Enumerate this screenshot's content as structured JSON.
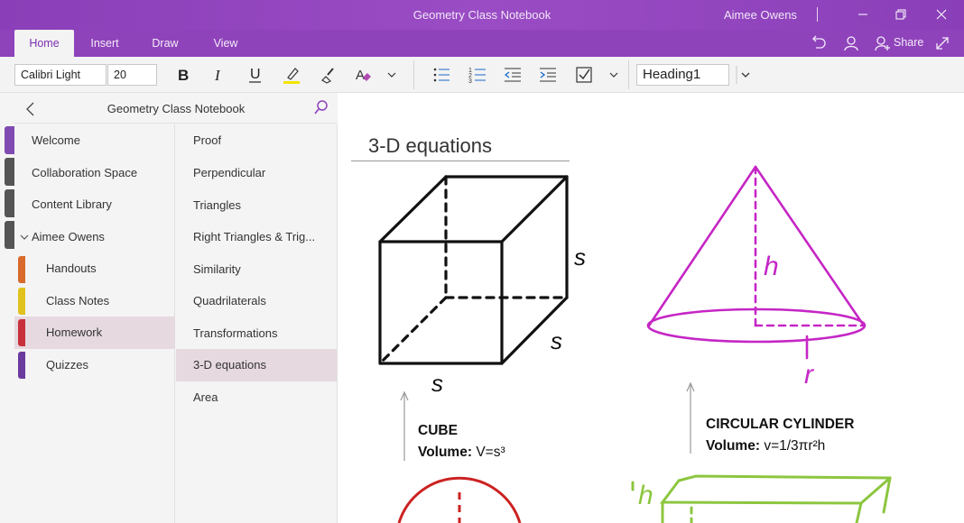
{
  "window": {
    "title": "Geometry Class Notebook",
    "user": "Aimee Owens"
  },
  "ribbon": {
    "tabs": [
      {
        "label": "Home",
        "active": true
      },
      {
        "label": "Insert",
        "active": false
      },
      {
        "label": "Draw",
        "active": false
      },
      {
        "label": "View",
        "active": false
      }
    ],
    "share_label": "Share"
  },
  "toolbar": {
    "font_name": "Calibri Light",
    "font_size": "20",
    "style": "Heading1"
  },
  "nav": {
    "notebook_title": "Geometry Class Notebook",
    "sections": [
      {
        "label": "Welcome",
        "color": "#7f4bb0"
      },
      {
        "label": "Collaboration Space",
        "color": "#555555"
      },
      {
        "label": "Content Library",
        "color": "#555555"
      },
      {
        "label": "Aimee Owens",
        "color": "#555555"
      },
      {
        "label": "Handouts",
        "color": "#d86a2c"
      },
      {
        "label": "Class Notes",
        "color": "#e0c21e"
      },
      {
        "label": "Homework",
        "color": "#c8303c"
      },
      {
        "label": "Quizzes",
        "color": "#6a3a9e"
      }
    ],
    "pages": [
      {
        "label": "Proof"
      },
      {
        "label": "Perpendicular"
      },
      {
        "label": "Triangles"
      },
      {
        "label": "Right Triangles & Trig..."
      },
      {
        "label": "Similarity"
      },
      {
        "label": "Quadrilaterals"
      },
      {
        "label": "Transformations"
      },
      {
        "label": "3-D equations"
      },
      {
        "label": "Area"
      }
    ]
  },
  "page": {
    "title": "3-D equations",
    "cube": {
      "name": "CUBE",
      "volume_label": "Volume:",
      "formula": "V=s³",
      "side_label": "s"
    },
    "cone": {
      "name": "CIRCULAR CYLINDER",
      "volume_label": "Volume:",
      "formula": "v=1/3πr²h",
      "height_label": "h",
      "radius_label": "r"
    },
    "prism": {
      "height_label": "h"
    }
  },
  "colors": {
    "accent": "#8f43bb",
    "cone": "#c526c5",
    "sphere": "#cc2222",
    "prism": "#8cc63f"
  }
}
